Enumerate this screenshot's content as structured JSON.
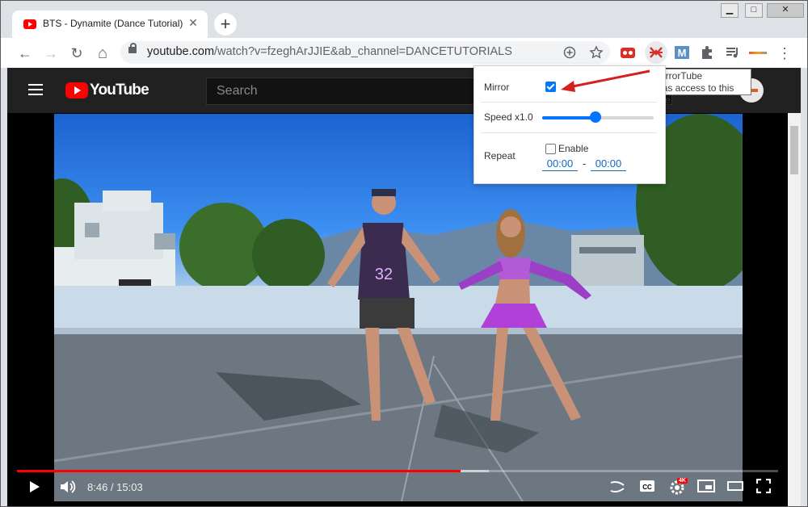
{
  "tab": {
    "title": "BTS - Dynamite (Dance Tutorial)",
    "close_glyph": "✕",
    "new_tab_glyph": "+"
  },
  "window_controls": {
    "minimize": "▁",
    "maximize": "□",
    "close": "✕"
  },
  "toolbar": {
    "back_glyph": "←",
    "forward_glyph": "→",
    "reload_glyph": "↻",
    "home_glyph": "⌂",
    "url_host": "youtube.com",
    "url_path": "/watch?v=fzeghArJJIE&ab_channel=DANCETUTORIALS",
    "menu_glyph": "⋮"
  },
  "youtube": {
    "logo_text": "YouTube",
    "search_placeholder": "Search",
    "player": {
      "current_time": "8:46",
      "duration": "15:03",
      "time_display": "8:46 / 15:03",
      "played_fraction": 0.583,
      "buffered_fraction": 0.62,
      "quality_badge": "4K"
    }
  },
  "mirror_popup": {
    "mirror_label": "Mirror",
    "mirror_checked": true,
    "speed_label": "Speed x1.0",
    "speed_value_fraction": 0.48,
    "repeat_label": "Repeat",
    "enable_label": "Enable",
    "enable_checked": false,
    "start_time": "00:00",
    "dash": "-",
    "end_time": "00:00"
  },
  "tooltip": {
    "title": "MirrorTube",
    "subtitle": "Has access to this site"
  },
  "colors": {
    "youtube_red": "#ff0000",
    "accent_blue": "#0075ff",
    "arrow_red": "#d42020"
  }
}
